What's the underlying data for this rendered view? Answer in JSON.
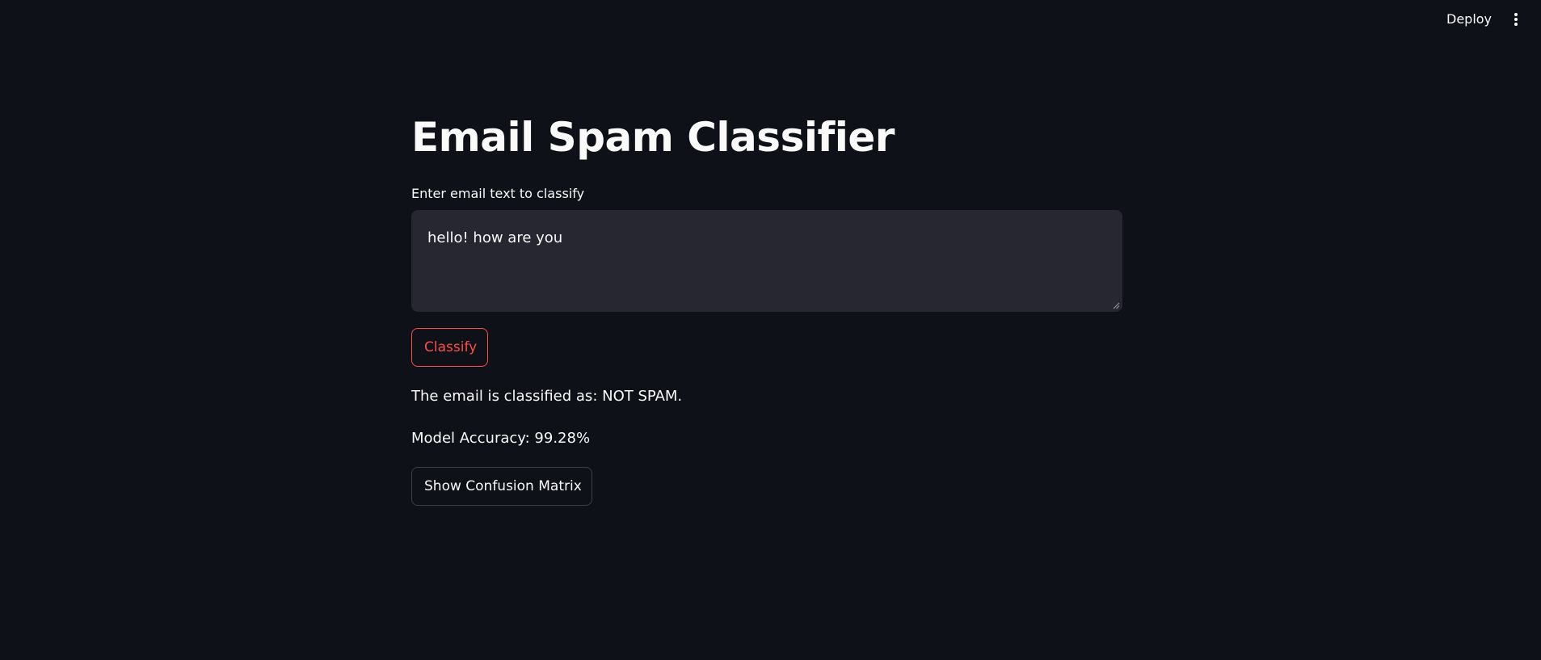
{
  "header": {
    "deploy_label": "Deploy",
    "menu_icon": "vertical-ellipsis-icon"
  },
  "main": {
    "title": "Email Spam Classifier",
    "input": {
      "label": "Enter email text to classify",
      "value": "hello! how are you"
    },
    "classify_label": "Classify",
    "result_text": "The email is classified as: NOT SPAM.",
    "accuracy_text": "Model Accuracy: 99.28%",
    "confusion_matrix_label": "Show Confusion Matrix"
  },
  "colors": {
    "background": "#0e1117",
    "input_background": "#262730",
    "accent": "#ff4b4b",
    "text": "#fafafa"
  }
}
